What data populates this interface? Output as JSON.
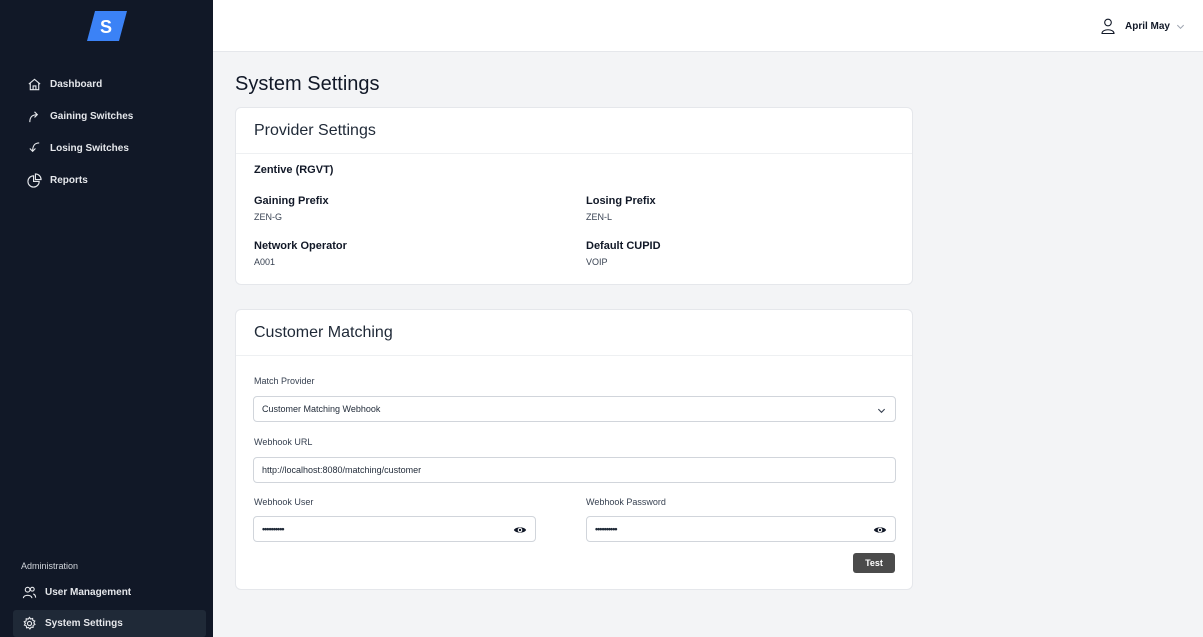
{
  "sidebar": {
    "logo_letter": "S",
    "nav": [
      {
        "label": "Dashboard",
        "icon": "home-icon"
      },
      {
        "label": "Gaining Switches",
        "icon": "arrow-up-curve-icon"
      },
      {
        "label": "Losing Switches",
        "icon": "arrow-down-curve-icon"
      },
      {
        "label": "Reports",
        "icon": "pie-chart-icon"
      }
    ],
    "admin_title": "Administration",
    "admin_nav": [
      {
        "label": "User Management",
        "icon": "users-icon"
      },
      {
        "label": "System Settings",
        "icon": "gear-icon",
        "active": true
      }
    ]
  },
  "header": {
    "user_name": "April May"
  },
  "page": {
    "title": "System Settings"
  },
  "provider": {
    "title": "Provider Settings",
    "name": "Zentive (RGVT)",
    "gaining_prefix_label": "Gaining Prefix",
    "gaining_prefix_value": "ZEN-G",
    "losing_prefix_label": "Losing Prefix",
    "losing_prefix_value": "ZEN-L",
    "network_operator_label": "Network Operator",
    "network_operator_value": "A001",
    "default_cupid_label": "Default CUPID",
    "default_cupid_value": "VOIP"
  },
  "matching": {
    "title": "Customer Matching",
    "match_provider_label": "Match Provider",
    "match_provider_value": "Customer Matching Webhook",
    "webhook_url_label": "Webhook URL",
    "webhook_url_value": "http://localhost:8080/matching/customer",
    "webhook_user_label": "Webhook User",
    "webhook_user_value": "••••••••••",
    "webhook_password_label": "Webhook Password",
    "webhook_password_value": "••••••••••",
    "test_label": "Test"
  },
  "colors": {
    "sidebar_bg": "#111827",
    "logo_blue": "#3b82f6",
    "button_bg": "#4b4b4b"
  }
}
